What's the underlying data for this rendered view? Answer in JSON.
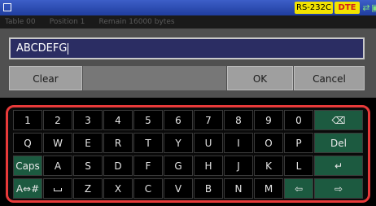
{
  "statusbar": {
    "interface": "RS-232C",
    "dte": "DTE",
    "icons": [
      "cable-icon",
      "network-icon",
      "storage-icon",
      "battery-icon"
    ]
  },
  "background_info": "Table 00      Position 1      Remain 16000 bytes",
  "input": {
    "value": "ABCDEFG"
  },
  "buttons": {
    "clear": "Clear",
    "ok": "OK",
    "cancel": "Cancel"
  },
  "keyboard": {
    "rows": [
      [
        "1",
        "2",
        "3",
        "4",
        "5",
        "6",
        "7",
        "8",
        "9",
        "0",
        "⌫"
      ],
      [
        "Q",
        "W",
        "E",
        "R",
        "T",
        "Y",
        "U",
        "I",
        "O",
        "P",
        "Del"
      ],
      [
        "Caps",
        "A",
        "S",
        "D",
        "F",
        "G",
        "H",
        "J",
        "K",
        "L",
        "↵"
      ],
      [
        "A⇔#",
        "␣",
        "Z",
        "X",
        "C",
        "V",
        "B",
        "N",
        "M",
        "⇦",
        "⇨"
      ]
    ]
  },
  "colors": {
    "keyboard_border": "#e83a3a",
    "special_key": "#1c5a40",
    "status_bar": "#2a4cb3"
  }
}
